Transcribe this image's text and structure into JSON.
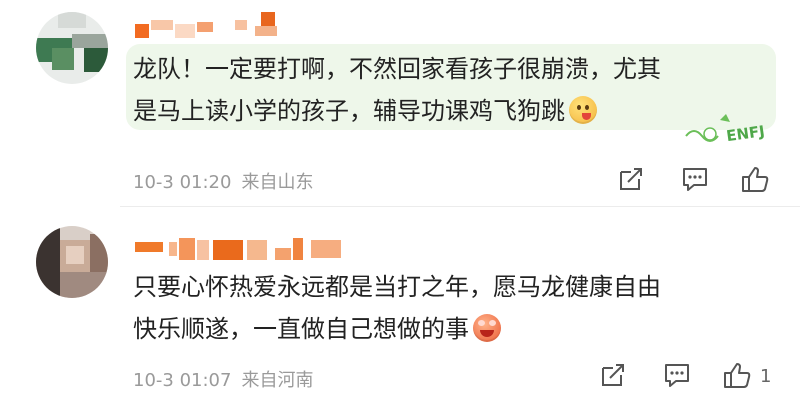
{
  "comments": [
    {
      "text_lines": [
        "龙队！一定要打啊，不然回家看孩子很崩溃，尤其",
        "是马上读小学的孩子，辅导功课鸡飞狗跳"
      ],
      "emoji": "tongue-out-emoji",
      "badge": "ENFJ",
      "time": "10-3 01:20",
      "location": "来自山东",
      "likes": ""
    },
    {
      "text_lines": [
        "只要心怀热爱永远都是当打之年，愿马龙健康自由",
        "快乐顺遂，一直做自己想做的事"
      ],
      "emoji": "blushing-laugh-emoji",
      "time": "10-3 01:07",
      "location": "来自河南",
      "likes": "1"
    }
  ],
  "icons": {
    "share": "share-icon",
    "comment": "comment-icon",
    "like": "thumbs-up-icon"
  },
  "colors": {
    "bubble": "#eef7ea",
    "meta_text": "#9a9a9a",
    "name_blur": "#f06a1a"
  }
}
